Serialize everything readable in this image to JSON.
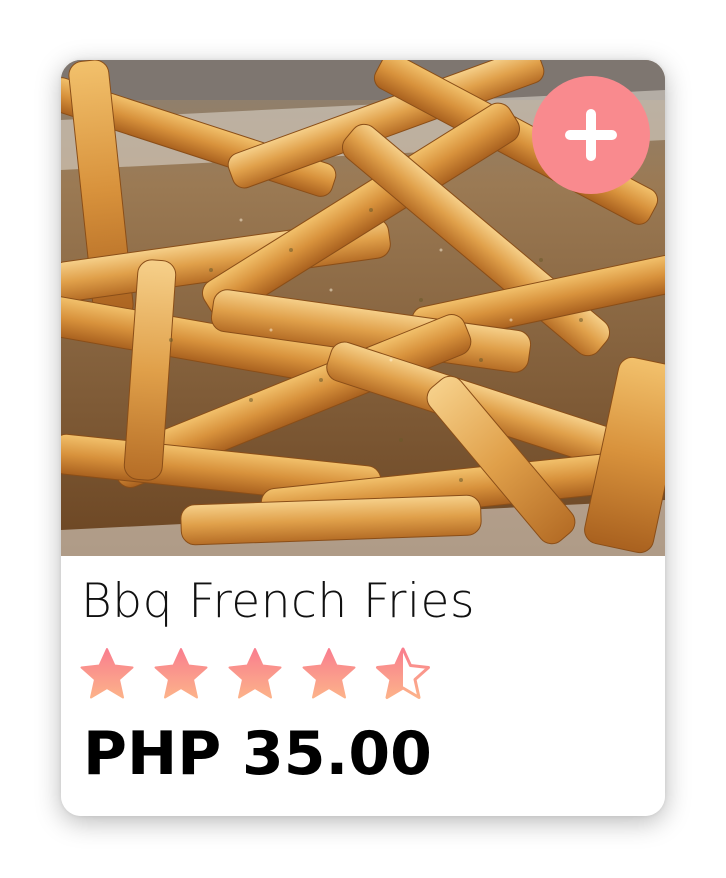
{
  "product": {
    "name": "Bbq French Fries",
    "price": "PHP 35.00",
    "rating": 4.5,
    "rating_max": 5,
    "image_icon": "fries-photo",
    "add_icon": "plus-icon"
  },
  "colors": {
    "accent": "#f98a8e",
    "star_top": "#f97e8e",
    "star_bottom": "#fcb28a",
    "text": "#111111",
    "price": "#000000"
  }
}
